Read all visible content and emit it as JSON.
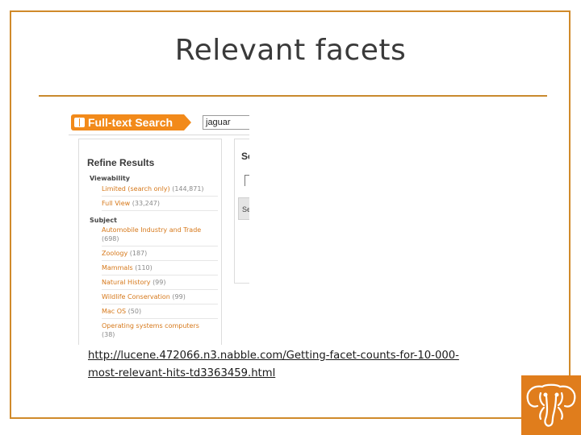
{
  "slide": {
    "title": "Relevant facets",
    "link_line1": "http://lucene.472066.n3.nabble.com/Getting-facet-counts-for-10-000-",
    "link_line2": "most-relevant-hits-td3363459.html"
  },
  "colors": {
    "frame": "#d08a2a",
    "accent": "#f28a1a",
    "facet_link": "#d6781a",
    "logo_bg": "#e07d1c"
  },
  "screenshot": {
    "search_label": "Full-text Search",
    "search_value": "jaguar",
    "refine_title": "Refine Results",
    "right_panel_heading": "Se",
    "right_panel_button": "Se",
    "groups": [
      {
        "title": "Viewability",
        "facets": [
          {
            "label": "Limited (search only)",
            "count": "(144,871)"
          },
          {
            "label": "Full View",
            "count": "(33,247)"
          }
        ]
      },
      {
        "title": "Subject",
        "facets": [
          {
            "label": "Automobile Industry and Trade",
            "count": "(698)"
          },
          {
            "label": "Zoology",
            "count": "(187)"
          },
          {
            "label": "Mammals",
            "count": "(110)"
          },
          {
            "label": "Natural History",
            "count": "(99)"
          },
          {
            "label": "Wildlife Conservation",
            "count": "(99)"
          },
          {
            "label": "Mac OS",
            "count": "(50)"
          },
          {
            "label": "Operating systems computers",
            "count": "(38)"
          }
        ]
      }
    ]
  },
  "logo": {
    "icon": "elephant-logo-icon"
  }
}
